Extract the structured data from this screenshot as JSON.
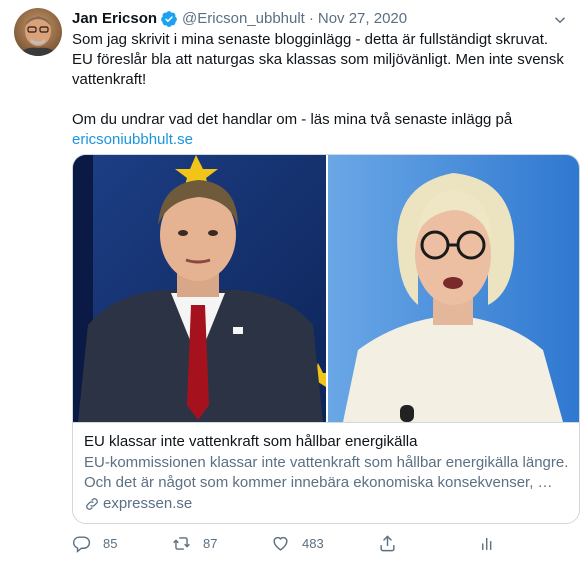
{
  "tweet": {
    "author_name": "Jan Ericson",
    "handle": "@Ericson_ubbhult",
    "separator": "·",
    "date": "Nov 27, 2020",
    "text_paragraph_1": "Som jag skrivit i mina senaste blogginlägg - detta är fullständigt skruvat. EU föreslår bla att naturgas ska klassas som miljövänligt. Men inte svensk vattenkraft!",
    "text_paragraph_2": "Om du undrar vad det handlar om - läs mina två senaste inlägg på",
    "text_link": "ericsoniubbhult.se"
  },
  "card": {
    "title": "EU klassar inte vattenkraft som hållbar energikälla",
    "description": "EU-kommissionen klassar inte vattenkraft som hållbar energikälla längre. Och det är något som kommer innebära ekonomiska konsekvenser, …",
    "domain": "expressen.se"
  },
  "actions": {
    "reply_count": "85",
    "retweet_count": "87",
    "like_count": "483"
  },
  "icons": {
    "verified": "verified-badge-icon",
    "more": "chevron-down-icon",
    "link": "link-icon",
    "reply": "reply-icon",
    "retweet": "retweet-icon",
    "like": "heart-icon",
    "share": "share-icon",
    "analytics": "analytics-icon"
  },
  "colors": {
    "link_blue": "#1b95e0",
    "secondary_text": "#5b7083",
    "verified_blue": "#1da1f2",
    "border": "#cfd9de"
  }
}
